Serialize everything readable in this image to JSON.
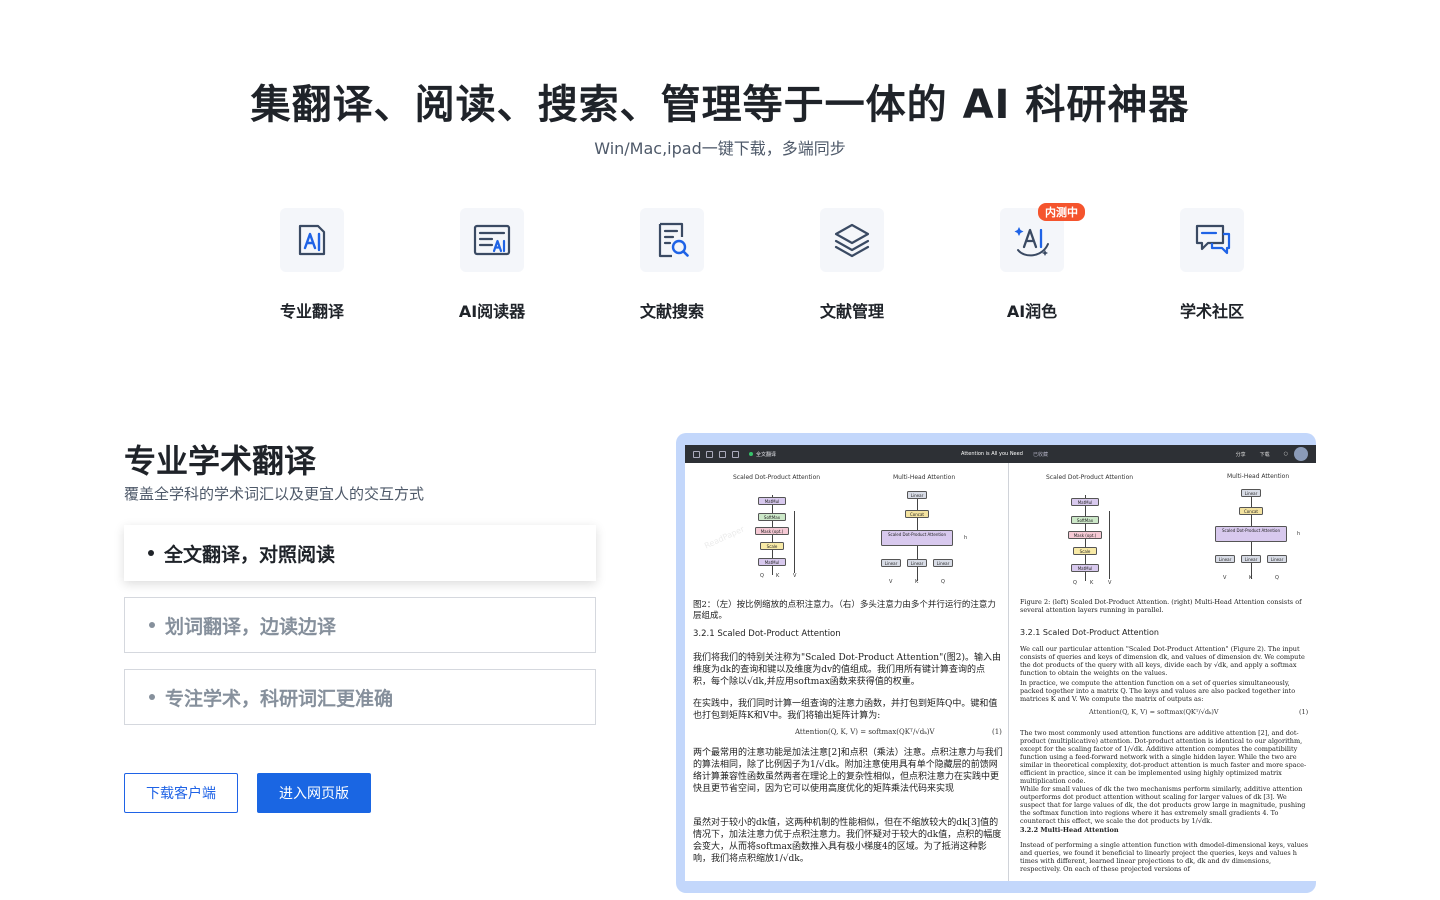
{
  "hero": {
    "title": "集翻译、阅读、搜索、管理等于一体的 AI 科研神器",
    "subtitle": "Win/Mac,ipad一键下载，多端同步"
  },
  "features": [
    {
      "label": "专业翻译",
      "icon": "translate-icon"
    },
    {
      "label": "AI阅读器",
      "icon": "ai-reader-icon"
    },
    {
      "label": "文献搜索",
      "icon": "document-search-icon"
    },
    {
      "label": "文献管理",
      "icon": "layers-icon"
    },
    {
      "label": "AI润色",
      "icon": "ai-polish-icon",
      "badge": "内测中"
    },
    {
      "label": "学术社区",
      "icon": "community-chat-icon"
    }
  ],
  "section": {
    "title": "专业学术翻译",
    "subtitle": "覆盖全学科的学术词汇以及更宜人的交互方式",
    "bullets": [
      {
        "text": "全文翻译，对照阅读",
        "active": true
      },
      {
        "text": "划词翻译，边读边译",
        "active": false
      },
      {
        "text": "专注学术，科研词汇更准确",
        "active": false
      }
    ],
    "buttons": {
      "download": "下载客户端",
      "web": "进入网页版"
    }
  },
  "preview": {
    "toolbar": {
      "tab": "全文翻译",
      "doc_title": "Attention is All you Need",
      "saved": "已收藏",
      "share": "分享",
      "download": "下载"
    },
    "left": {
      "diagram_title_1": "Scaled Dot-Product Attention",
      "diagram_title_2": "Multi-Head Attention",
      "caption": "图2：（左）按比例缩放的点积注意力。（右）多头注意力由多个并行运行的注意力层组成。",
      "heading": "3.2.1   Scaled Dot-Product Attention",
      "p1": "我们将我们的特别关注称为\"Scaled Dot-Product Attention\"(图2)。输入由维度为dk的查询和键以及维度为dv的值组成。我们用所有键计算查询的点积，每个除以√dk,并应用softmax函数来获得值的权重。",
      "p2": "在实践中，我们同时计算一组查询的注意力函数，并打包到矩阵Q中。键和值也打包到矩阵K和V中。我们将输出矩阵计算为:",
      "formula": "Attention(Q, K, V) = softmax(QKᵀ/√dₖ)V",
      "formula_num": "(1)",
      "p3": "两个最常用的注意功能是加法注意[2]和点积（乘法）注意。点积注意力与我们的算法相同，除了比例因子为1/√dk。附加注意使用具有单个隐藏层的前馈网络计算兼容性函数虽然两者在理论上的复杂性相似，但点积注意力在实践中更快且更节省空间，因为它可以使用高度优化的矩阵乘法代码来实现",
      "p4": "虽然对于较小的dk值，这两种机制的性能相似，但在不缩放较大的dk[3]值的情况下，加法注意力优于点积注意力。我们怀疑对于较大的dk值，点积的幅度会变大，从而将softmax函数推入具有极小梯度4的区域。为了抵消这种影响，我们将点积缩放1/√dk。"
    },
    "right": {
      "diagram_title_1": "Scaled Dot-Product Attention",
      "diagram_title_2": "Multi-Head Attention",
      "caption": "Figure 2: (left) Scaled Dot-Product Attention. (right) Multi-Head Attention consists of several attention layers running in parallel.",
      "heading": "3.2.1   Scaled Dot-Product Attention",
      "p1": "We call our particular attention \"Scaled Dot-Product Attention\" (Figure 2). The input consists of queries and keys of dimension dk, and values of dimension dv. We compute the dot products of the query with all keys, divide each by √dk, and apply a softmax function to obtain the weights on the values.",
      "p2": "In practice, we compute the attention function on a set of queries simultaneously, packed together into a matrix Q. The keys and values are also packed together into matrices K and V. We compute the matrix of outputs as:",
      "formula": "Attention(Q, K, V) = softmax(QKᵀ/√dₖ)V",
      "formula_num": "(1)",
      "p3": "The two most commonly used attention functions are additive attention [2], and dot-product (multiplicative) attention. Dot-product attention is identical to our algorithm, except for the scaling factor of 1/√dk. Additive attention computes the compatibility function using a feed-forward network with a single hidden layer. While the two are similar in theoretical complexity, dot-product attention is much faster and more space-efficient in practice, since it can be implemented using highly optimized matrix multiplication code.",
      "p4": "While for small values of dk the two mechanisms perform similarly, additive attention outperforms dot product attention without scaling for larger values of dk [3]. We suspect that for large values of dk, the dot products grow large in magnitude, pushing the softmax function into regions where it has extremely small gradients 4. To counteract this effect, we scale the dot products by 1/√dk.",
      "heading2": "3.2.2   Multi-Head Attention",
      "p5": "Instead of performing a single attention function with dmodel-dimensional keys, values and queries, we found it beneficial to linearly project the queries, keys and values h times with different, learned linear projections to dk, dk and dv dimensions, respectively. On each of these projected versions of"
    },
    "diagram": {
      "matmul": "MatMul",
      "softmax": "SoftMax",
      "mask": "Mask (opt.)",
      "scale": "Scale",
      "linear": "Linear",
      "concat": "Concat",
      "sdpa": "Scaled Dot-Product Attention",
      "q": "Q",
      "k": "K",
      "v": "V",
      "h": "h"
    }
  }
}
